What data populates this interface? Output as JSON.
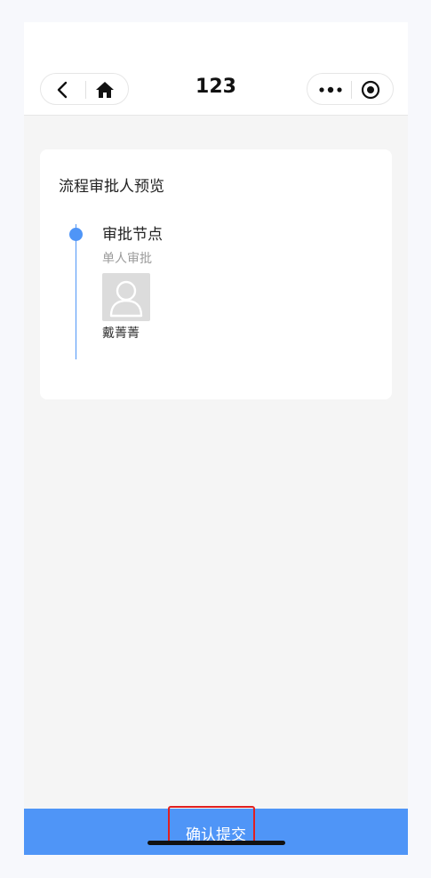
{
  "nav": {
    "title": "123",
    "back_icon": "chevron-left-icon",
    "home_icon": "home-icon",
    "more_icon": "more-dots-icon",
    "capsule_close_icon": "target-circle-icon"
  },
  "card": {
    "title": "流程审批人预览",
    "node": {
      "title": "审批节点",
      "subtitle": "单人审批",
      "approver": {
        "name": "戴菁菁",
        "avatar_icon": "user-avatar-icon"
      }
    }
  },
  "footer": {
    "submit_label": "确认提交"
  },
  "colors": {
    "accent": "#4f95f7",
    "highlight": "#e02020"
  }
}
